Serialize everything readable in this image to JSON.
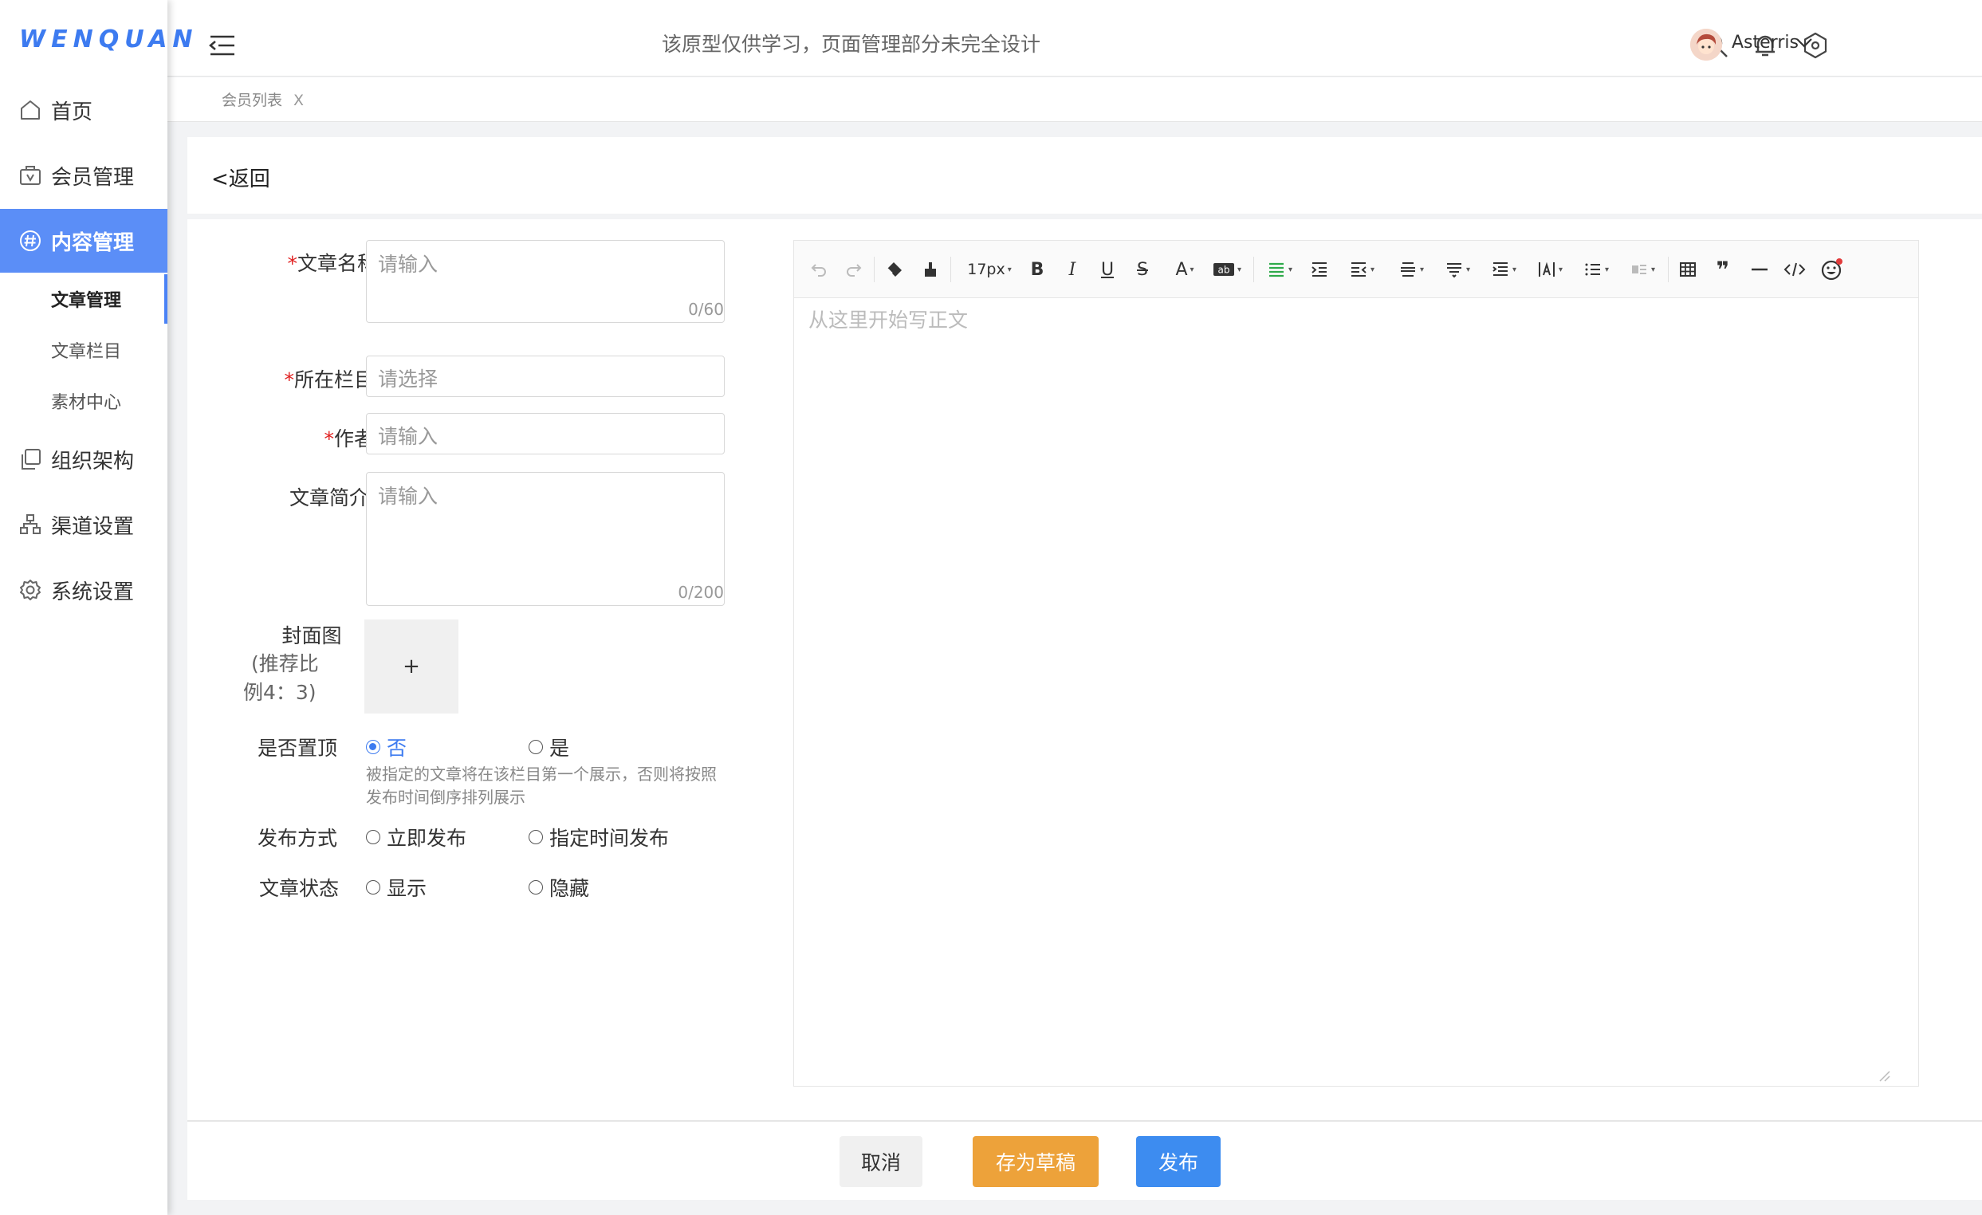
{
  "app": {
    "logo": "WENQUAN",
    "notice": "该原型仅供学习，页面管理部分未完全设计",
    "username": "Asterris"
  },
  "sidebar": {
    "items": [
      {
        "label": "首页",
        "icon": "home-icon"
      },
      {
        "label": "会员管理",
        "icon": "member-icon"
      },
      {
        "label": "内容管理",
        "icon": "hash-icon",
        "active": true
      },
      {
        "label": "组织架构",
        "icon": "org-icon"
      },
      {
        "label": "渠道设置",
        "icon": "channel-icon"
      },
      {
        "label": "系统设置",
        "icon": "gear-icon"
      }
    ],
    "sub_items": [
      {
        "label": "文章管理",
        "active": true
      },
      {
        "label": "文章栏目"
      },
      {
        "label": "素材中心"
      }
    ]
  },
  "tabs": {
    "member_list": "会员列表",
    "close": "X"
  },
  "back_label": "<返回",
  "form": {
    "title_label": "文章名称",
    "title_placeholder": "请输入",
    "title_counter": "0/60",
    "column_label": "所在栏目",
    "column_placeholder": "请选择",
    "author_label": "作者",
    "author_placeholder": "请输入",
    "summary_label": "文章简介",
    "summary_placeholder": "请输入",
    "summary_counter": "0/200",
    "cover_label_1": "封面图",
    "cover_label_2": "(推荐比",
    "cover_label_3": "例4：3)",
    "cover_plus": "+",
    "pin_label": "是否置顶",
    "pin_no": "否",
    "pin_yes": "是",
    "pin_hint": "被指定的文章将在该栏目第一个展示，否则将按照发布时间倒序排列展示",
    "publish_label": "发布方式",
    "publish_now": "立即发布",
    "publish_scheduled": "指定时间发布",
    "status_label": "文章状态",
    "status_show": "显示",
    "status_hide": "隐藏"
  },
  "editor": {
    "font_size": "17px",
    "placeholder": "从这里开始写正文"
  },
  "buttons": {
    "cancel": "取消",
    "draft": "存为草稿",
    "publish": "发布"
  },
  "colors": {
    "accent": "#3d7bf0",
    "sidebar_active": "#5b8ef7",
    "draft": "#eda23a",
    "publish": "#3d8cf0"
  }
}
